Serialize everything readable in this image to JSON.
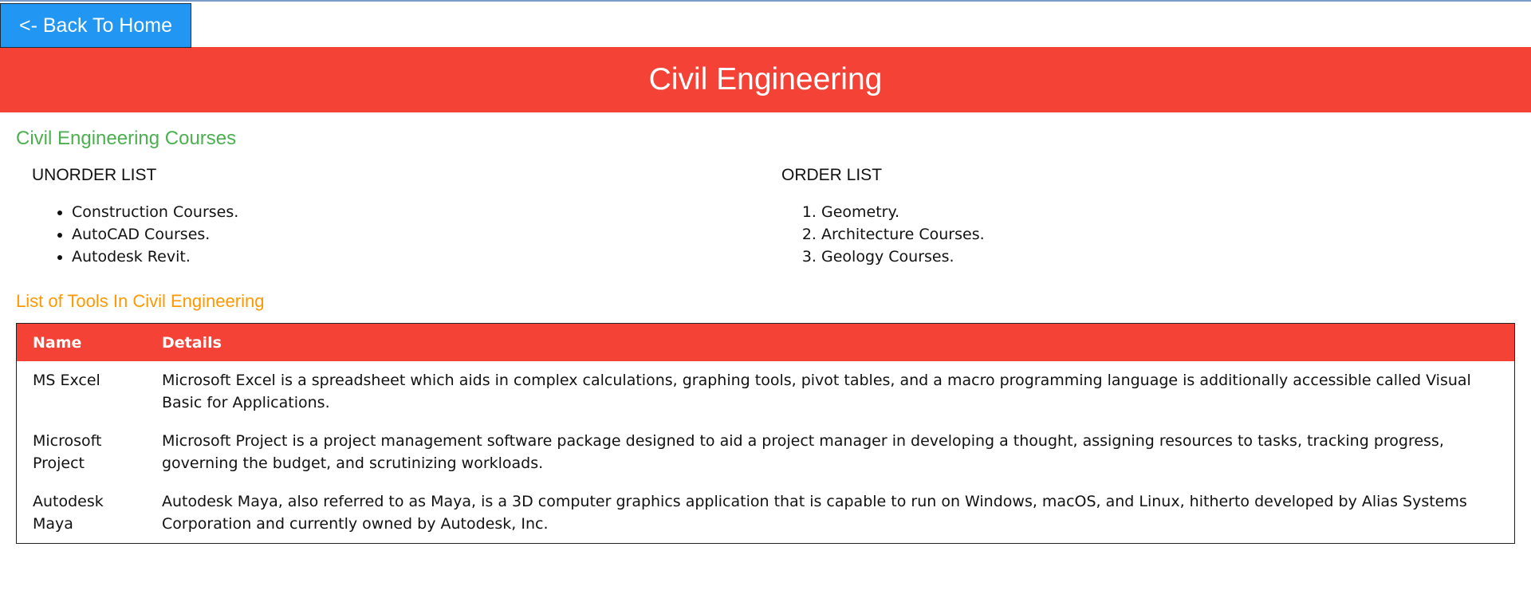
{
  "back_button": {
    "label": "<- Back To Home"
  },
  "banner": {
    "title": "Civil Engineering"
  },
  "courses": {
    "heading": "Civil Engineering Courses",
    "unordered": {
      "title": "UNORDER LIST",
      "items": [
        "Construction Courses.",
        "AutoCAD Courses.",
        "Autodesk Revit."
      ]
    },
    "ordered": {
      "title": "ORDER LIST",
      "items": [
        "Geometry.",
        "Architecture Courses.",
        "Geology Courses."
      ]
    }
  },
  "tools": {
    "heading": "List of Tools In Civil Engineering",
    "columns": [
      "Name",
      "Details"
    ],
    "rows": [
      {
        "name": "MS Excel",
        "details": "Microsoft Excel is a spreadsheet which aids in complex calculations, graphing tools, pivot tables, and a macro programming language is additionally accessible called Visual Basic for Applications."
      },
      {
        "name": "Microsoft Project",
        "details": "Microsoft Project is a project management software package designed to aid a project manager in developing a thought, assigning resources to tasks, tracking progress, governing the budget, and scrutinizing workloads."
      },
      {
        "name": "Autodesk Maya",
        "details": "Autodesk Maya, also referred to as Maya, is a 3D computer graphics application that is capable to run on Windows, macOS, and Linux, hitherto developed by Alias Systems Corporation and currently owned by Autodesk, Inc."
      }
    ]
  },
  "colors": {
    "banner": "#f44336",
    "back_button": "#2196f3",
    "courses_heading": "#4caf50",
    "tools_heading": "#ff9800"
  }
}
